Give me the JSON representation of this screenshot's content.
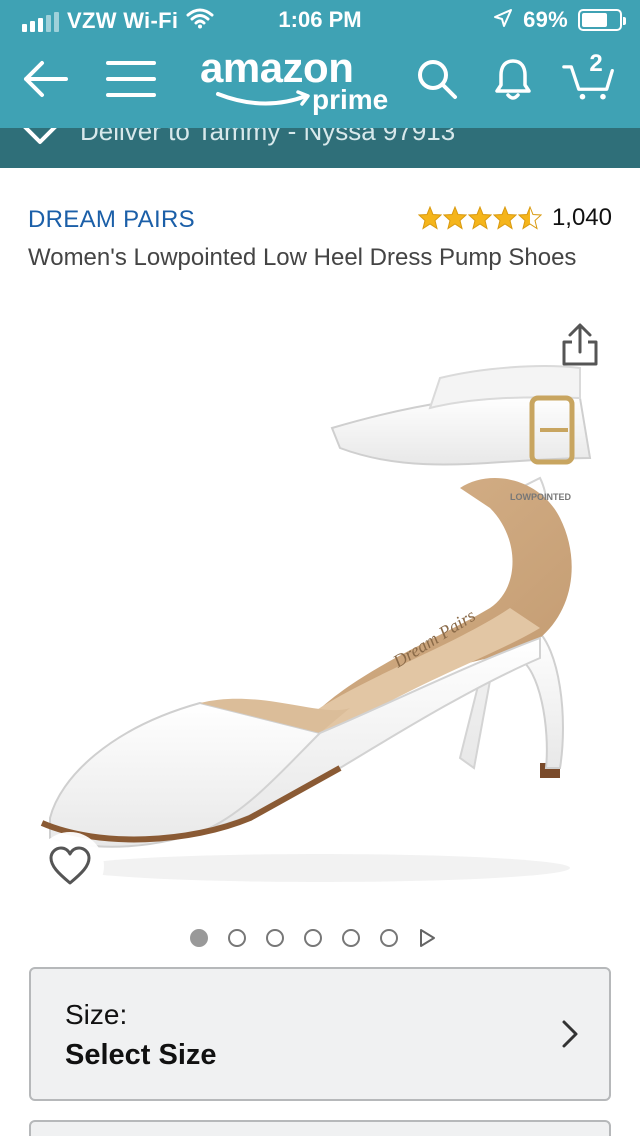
{
  "status_bar": {
    "carrier": "VZW Wi-Fi",
    "time": "1:06 PM",
    "battery": "69%",
    "battery_level": 0.69
  },
  "nav": {
    "logo_amazon": "amazon",
    "logo_prime": "prime",
    "cart_count": "2",
    "icons": [
      "back-arrow-icon",
      "menu-icon",
      "search-icon",
      "bell-icon",
      "cart-icon"
    ]
  },
  "deliver": {
    "text": "Deliver to Tammy - Nyssa 97913"
  },
  "product": {
    "brand": "DREAM PAIRS",
    "rating": 4.5,
    "rating_count": "1,040",
    "title": "Women's Lowpointed Low Heel Dress Pump Shoes",
    "image_count": 6,
    "active_image": 0
  },
  "size_selector": {
    "label": "Size:",
    "value": "Select Size"
  },
  "colors": {
    "header": "#3fa2b4",
    "deliver_bar": "#2f6f79",
    "brand_link": "#1b5fa8",
    "star": "#f5b51b"
  }
}
